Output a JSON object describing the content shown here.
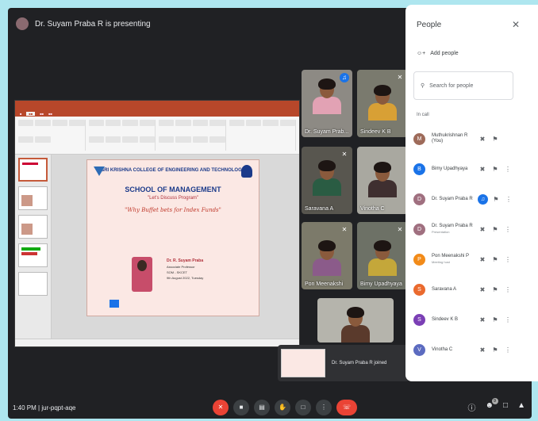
{
  "presenting": {
    "text": "Dr. Suyam Praba R is presenting"
  },
  "slide": {
    "college": "SRI KRISHNA COLLEGE OF ENGINEERING AND TECHNOLOGY",
    "school": "SCHOOL OF MANAGEMENT",
    "program": "\"Let's Discuss Program\"",
    "topic": "\"Why Buffet bets for Index Funds\"",
    "speaker_name": "Dr. R. Suyam Praba",
    "speaker_role": "Associate Professor",
    "speaker_dept": "SOM - SKCET",
    "date": "9th August 2022, Tuesday"
  },
  "tiles": [
    {
      "name": "Dr. Suyam Prab...",
      "speaking": true
    },
    {
      "name": "Sindeev K B"
    },
    {
      "name": "Saravana A"
    },
    {
      "name": "Vinotha C"
    },
    {
      "name": "Pon Meenakshi"
    },
    {
      "name": "Bimy Upadhyaya"
    },
    {
      "name": ""
    }
  ],
  "toast": {
    "text": "Dr. Suyam Praba R joined"
  },
  "people": {
    "title": "People",
    "add": "Add people",
    "search_placeholder": "Search for people",
    "section": "In call",
    "participants": [
      {
        "name": "Muthukrishnan R (You)",
        "role": "",
        "initial": "M",
        "color": "#9e6b5a",
        "speaking": false
      },
      {
        "name": "Bimy Upadhyaya",
        "role": "",
        "initial": "B",
        "color": "#1a73e8",
        "speaking": false
      },
      {
        "name": "Dr. Suyam Praba R",
        "role": "",
        "initial": "D",
        "color": "#a07080",
        "speaking": true
      },
      {
        "name": "Dr. Suyam Praba R",
        "role": "Presentation",
        "initial": "D",
        "color": "#a07080",
        "speaking": false
      },
      {
        "name": "Pon Meenakshi P",
        "role": "Meeting host",
        "initial": "P",
        "color": "#f28b19",
        "speaking": false
      },
      {
        "name": "Saravana A",
        "role": "",
        "initial": "S",
        "color": "#ea6a2e",
        "speaking": false
      },
      {
        "name": "Sindeev K B",
        "role": "",
        "initial": "S",
        "color": "#7b3fb5",
        "speaking": false
      },
      {
        "name": "Vinotha C",
        "role": "",
        "initial": "V",
        "color": "#5c6bc0",
        "speaking": false
      }
    ]
  },
  "bottom": {
    "time": "1:40 PM",
    "code": "jur-pqpt-aqe",
    "participant_badge": "9"
  }
}
